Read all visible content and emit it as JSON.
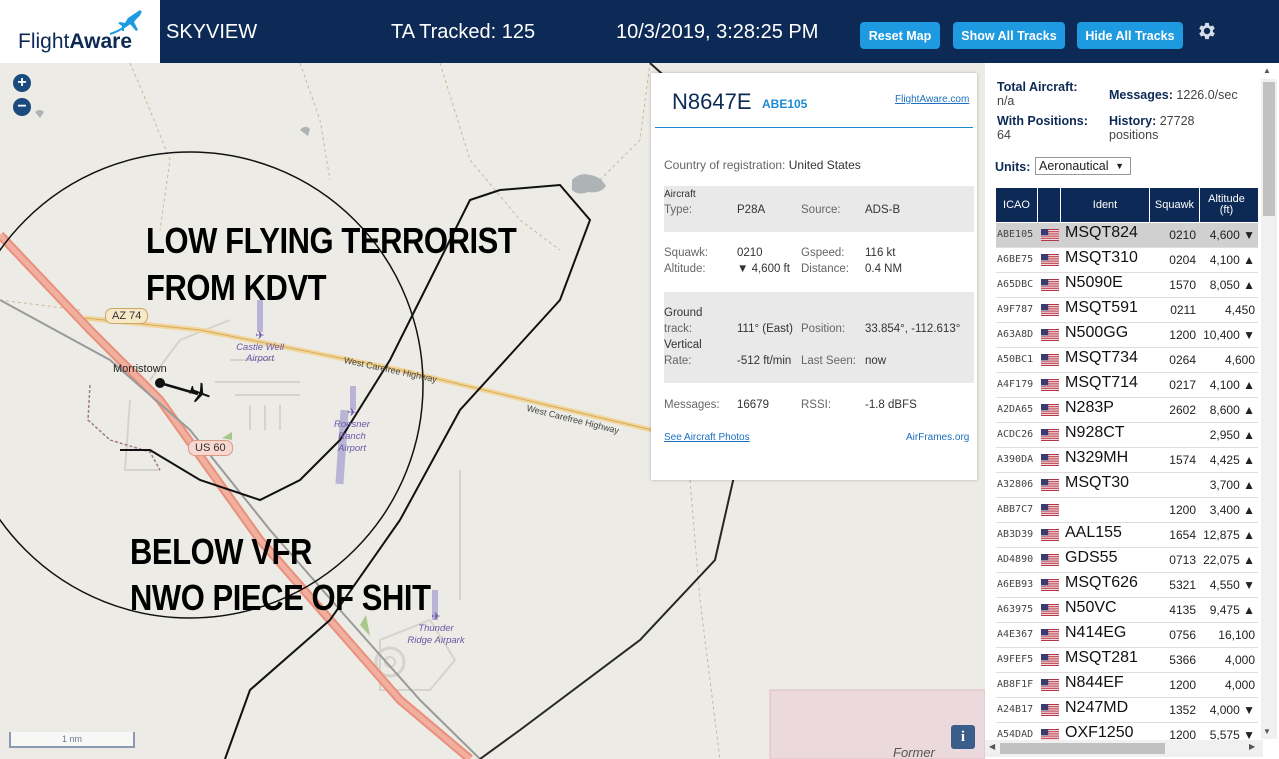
{
  "header": {
    "logo_text_a": "Flight",
    "logo_text_b": "Aware",
    "app_name": "SKYVIEW",
    "ta_tracked": "TA Tracked: 125",
    "datetime": "10/3/2019, 3:28:25 PM",
    "buttons": {
      "reset_map": "Reset Map",
      "show_all": "Show All Tracks",
      "hide_all": "Hide All Tracks"
    }
  },
  "map": {
    "zoom_in": "+",
    "zoom_out": "−",
    "scale_label": "1 nm",
    "info": "i",
    "roads": {
      "az74": "AZ 74",
      "us60": "US 60",
      "carefree1": "West Carefree Highway",
      "carefree2": "West Carefree Highway"
    },
    "places": {
      "morristown": "Morristown",
      "castle_well_a": "Castle Well",
      "castle_well_b": "Airport",
      "roesner_a": "Roesner",
      "roesner_b": "Ranch",
      "roesner_c": "Airport",
      "thunder_a": "Thunder",
      "thunder_b": "Ridge Airpark",
      "former": "Former"
    },
    "overlay_text": {
      "line1": "LOW FLYING TERRORIST",
      "line2": "FROM KDVT",
      "line3": "BELOW VFR",
      "line4": "NWO PIECE OF SHIT"
    }
  },
  "popup": {
    "registration": "N8647E",
    "callsign": "ABE105",
    "flightaware_link": "FlightAware.com",
    "country_label": "Country of registration:",
    "country_value": "United States",
    "type_label_a": "Aircraft",
    "type_label_b": "Type:",
    "type_value": "P28A",
    "source_label": "Source:",
    "source_value": "ADS-B",
    "squawk_label": "Squawk:",
    "squawk_value": "0210",
    "gspeed_label": "Gspeed:",
    "gspeed_value": "116 kt",
    "altitude_label": "Altitude:",
    "altitude_value": "▼ 4,600 ft",
    "distance_label": "Distance:",
    "distance_value": "0.4 NM",
    "ground_label_a": "Ground",
    "ground_label_b": "track:",
    "ground_value": "111° (East)",
    "position_label": "Position:",
    "position_value": "33.854°, -112.613°",
    "vrate_label_a": "Vertical",
    "vrate_label_b": "Rate:",
    "vrate_value": "-512 ft/min",
    "lastseen_label": "Last Seen:",
    "lastseen_value": "now",
    "messages_label": "Messages:",
    "messages_value": "16679",
    "rssi_label": "RSSI:",
    "rssi_value": "-1.8 dBFS",
    "photos_link": "See Aircraft Photos",
    "airframes_link": "AirFrames.org"
  },
  "sidebar": {
    "total_aircraft_label": "Total Aircraft:",
    "total_aircraft_value": "n/a",
    "messages_label": "Messages:",
    "messages_value": "1226.0/sec",
    "with_positions_label": "With Positions:",
    "with_positions_value": "64",
    "history_label": "History:",
    "history_value": "27728",
    "history_unit": "positions",
    "units_label": "Units:",
    "units_value": "Aeronautical",
    "columns": {
      "icao": "ICAO",
      "ident": "Ident",
      "squawk": "Squawk",
      "altitude_a": "Altitude",
      "altitude_b": "(ft)"
    },
    "rows": [
      {
        "icao": "ABE105",
        "ident": "MSQT824",
        "squawk": "0210",
        "alt": "4,600 ▼"
      },
      {
        "icao": "A6BE75",
        "ident": "MSQT310",
        "squawk": "0204",
        "alt": "4,100 ▲"
      },
      {
        "icao": "A65DBC",
        "ident": "N5090E",
        "squawk": "1570",
        "alt": "8,050 ▲"
      },
      {
        "icao": "A9F787",
        "ident": "MSQT591",
        "squawk": "0211",
        "alt": "4,450"
      },
      {
        "icao": "A63A8D",
        "ident": "N500GG",
        "squawk": "1200",
        "alt": "10,400 ▼"
      },
      {
        "icao": "A50BC1",
        "ident": "MSQT734",
        "squawk": "0264",
        "alt": "4,600"
      },
      {
        "icao": "A4F179",
        "ident": "MSQT714",
        "squawk": "0217",
        "alt": "4,100 ▲"
      },
      {
        "icao": "A2DA65",
        "ident": "N283P",
        "squawk": "2602",
        "alt": "8,600 ▲"
      },
      {
        "icao": "ACDC26",
        "ident": "N928CT",
        "squawk": "",
        "alt": "2,950 ▲"
      },
      {
        "icao": "A390DA",
        "ident": "N329MH",
        "squawk": "1574",
        "alt": "4,425 ▲"
      },
      {
        "icao": "A32806",
        "ident": "MSQT30",
        "squawk": "",
        "alt": "3,700 ▲"
      },
      {
        "icao": "ABB7C7",
        "ident": "",
        "squawk": "1200",
        "alt": "3,400 ▲"
      },
      {
        "icao": "AB3D39",
        "ident": "AAL155",
        "squawk": "1654",
        "alt": "12,875 ▲"
      },
      {
        "icao": "AD4890",
        "ident": "GDS55",
        "squawk": "0713",
        "alt": "22,075 ▲"
      },
      {
        "icao": "A6EB93",
        "ident": "MSQT626",
        "squawk": "5321",
        "alt": "4,550 ▼"
      },
      {
        "icao": "A63975",
        "ident": "N50VC",
        "squawk": "4135",
        "alt": "9,475 ▲"
      },
      {
        "icao": "A4E367",
        "ident": "N414EG",
        "squawk": "0756",
        "alt": "16,100"
      },
      {
        "icao": "A9FEF5",
        "ident": "MSQT281",
        "squawk": "5366",
        "alt": "4,000"
      },
      {
        "icao": "AB8F1F",
        "ident": "N844EF",
        "squawk": "1200",
        "alt": "4,000"
      },
      {
        "icao": "A24B17",
        "ident": "N247MD",
        "squawk": "1352",
        "alt": "4,000 ▼"
      },
      {
        "icao": "A54DAD",
        "ident": "OXF1250",
        "squawk": "1200",
        "alt": "5,575 ▼"
      }
    ]
  },
  "colors": {
    "header_bg": "#0c2a55",
    "button": "#1d9ae0",
    "link": "#1d8ad0"
  },
  "icons": [
    "settings-gear-icon",
    "zoom-in-icon",
    "zoom-out-icon",
    "airplane-icon",
    "us-flag-icon",
    "info-icon"
  ]
}
